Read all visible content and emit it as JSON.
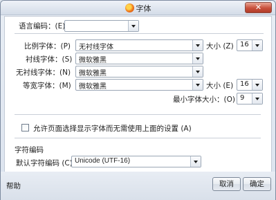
{
  "window": {
    "title": "字体",
    "close_glyph": "✕"
  },
  "fonts": {
    "language_label": "语言编码：(E)",
    "language_value": "",
    "proportional_label": "比例字体：(P)",
    "proportional_value": "无衬线字体",
    "size_label": "大小 (Z)",
    "size_value": "16",
    "serif_label": "衬线字体：(S)",
    "serif_value": "微软雅黑",
    "sans_label": "无衬线字体：(N)",
    "sans_value": "微软雅黑",
    "mono_label": "等宽字体：(M)",
    "mono_value": "微软雅黑",
    "mono_size_label": "大小 (E)",
    "mono_size_value": "16",
    "min_size_label": "最小字体大小：(O)",
    "min_size_value": "9"
  },
  "options": {
    "allow_pages_label": "允许页面选择显示字体而无需使用上面的设置 (A)",
    "allow_pages_checked": false
  },
  "encoding": {
    "group_title": "字符编码",
    "default_label": "默认字符编码 (C)",
    "default_value": "Unicode (UTF-16)"
  },
  "footer": {
    "help_label": "帮助",
    "cancel_label": "取消",
    "ok_label": "确定"
  }
}
